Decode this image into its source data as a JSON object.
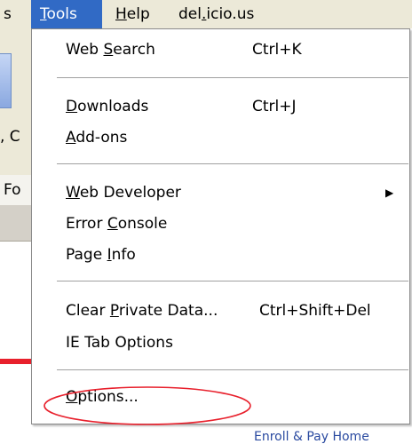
{
  "menubar": {
    "partial_left": "s",
    "items": [
      {
        "label": "Tools",
        "mnemonic": "T",
        "rest": "ools"
      },
      {
        "label": "Help",
        "mnemonic": "H",
        "rest": "elp"
      },
      {
        "label": "del.icio.us",
        "pre": "del",
        "mnemonic": ".",
        "rest": "icio.us"
      }
    ]
  },
  "background": {
    "row2_text": ", C",
    "row3_text": "Fo",
    "bottom_link": "Enroll & Pay Home"
  },
  "menu": {
    "items": [
      {
        "pre": "Web ",
        "mnemonic": "S",
        "post": "earch",
        "shortcut": "Ctrl+K"
      },
      {
        "pre": "",
        "mnemonic": "D",
        "post": "ownloads",
        "shortcut": "Ctrl+J"
      },
      {
        "pre": "",
        "mnemonic": "A",
        "post": "dd-ons",
        "shortcut": ""
      },
      {
        "pre": "",
        "mnemonic": "W",
        "post": "eb Developer",
        "shortcut": "",
        "submenu": true
      },
      {
        "pre": "Error ",
        "mnemonic": "C",
        "post": "onsole",
        "shortcut": ""
      },
      {
        "pre": "Page ",
        "mnemonic": "I",
        "post": "nfo",
        "shortcut": ""
      },
      {
        "pre": "Clear ",
        "mnemonic": "P",
        "post": "rivate Data...",
        "shortcut": "Ctrl+Shift+Del"
      },
      {
        "pre": "IE Tab Options",
        "mnemonic": "",
        "post": "",
        "shortcut": ""
      },
      {
        "pre": "",
        "mnemonic": "O",
        "post": "ptions...",
        "shortcut": ""
      }
    ]
  },
  "colors": {
    "menubar_bg": "#ece9d8",
    "active_menu": "#316ac5",
    "highlight_ellipse": "#e8202c"
  }
}
